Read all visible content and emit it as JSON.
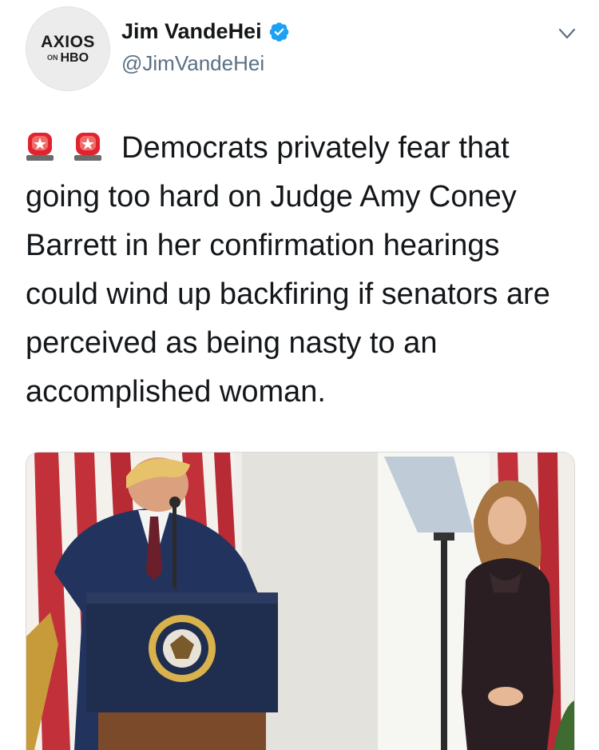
{
  "author": {
    "display_name": "Jim VandeHei",
    "handle": "@JimVandeHei",
    "verified": true,
    "avatar": {
      "brand": "AXIOS",
      "sub_small": "ON",
      "sub_large": "HBO"
    }
  },
  "tweet": {
    "text": "Democrats privately fear that going too hard on Judge Amy Coney Barrett in her confirmation hearings could wind up backfiring if senators are perceived as being nasty to an accomplished woman.",
    "leading_emoji": [
      "police-siren-emoji",
      "police-siren-emoji"
    ]
  },
  "media": {
    "description_icons": [
      "podium",
      "presidential-seal",
      "teleprompter",
      "flag"
    ],
    "seal_text": "SEAL OF THE PRESIDENT OF THE UNITED STATES"
  },
  "colors": {
    "verified_blue": "#1da1f2",
    "handle_gray": "#5b7083",
    "siren_red": "#e0242f"
  }
}
